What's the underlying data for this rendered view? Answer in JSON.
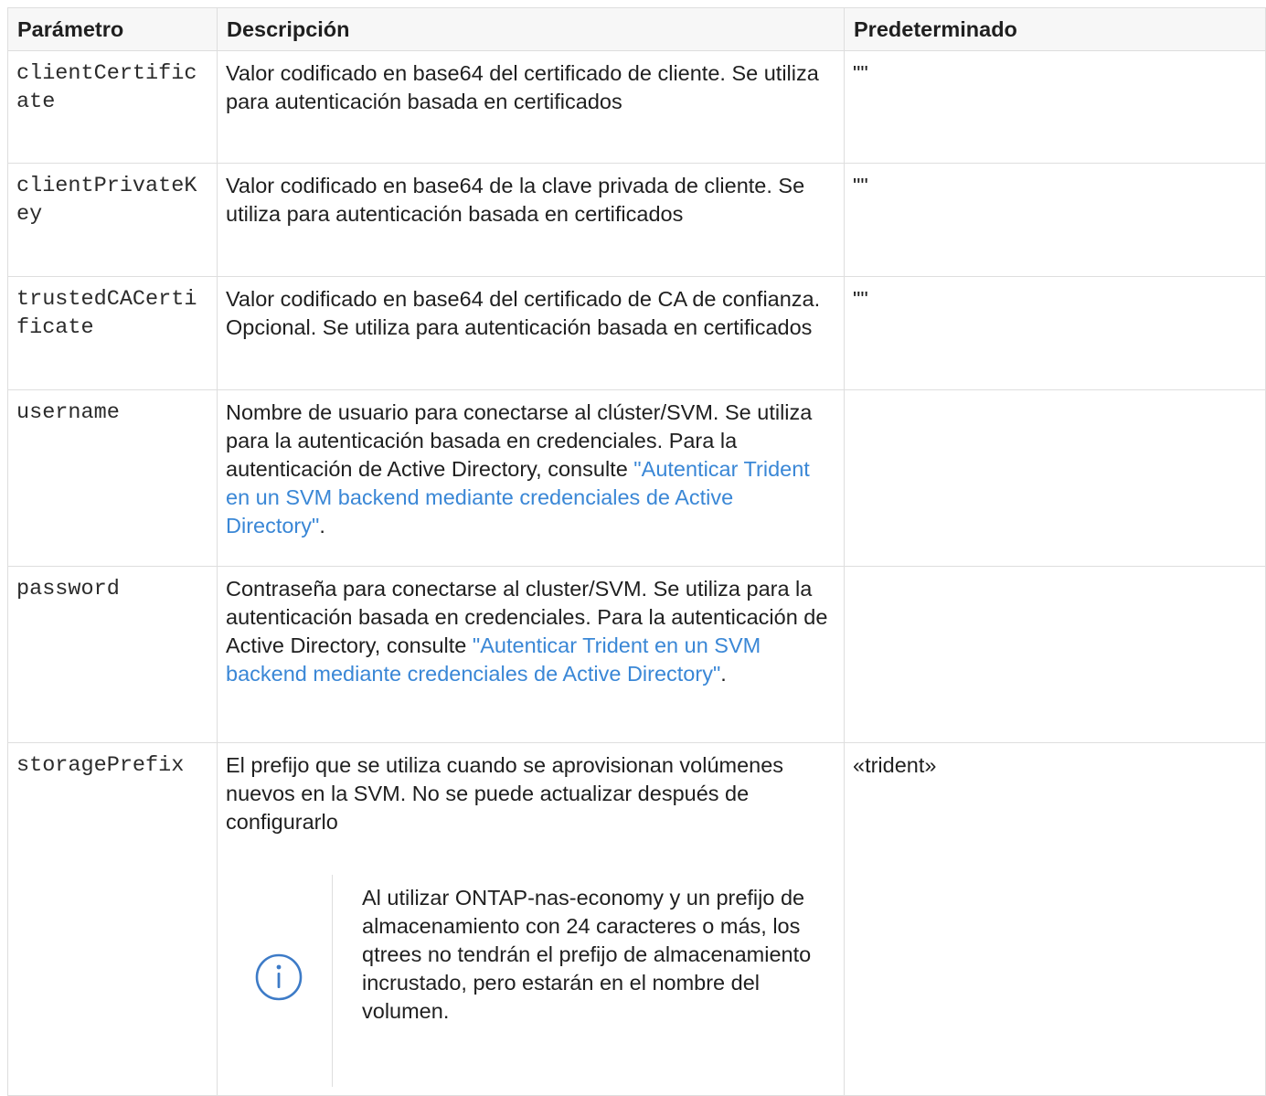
{
  "table": {
    "headers": {
      "parameter": "Parámetro",
      "description": "Descripción",
      "default": "Predeterminado"
    },
    "rows": [
      {
        "param": "clientCertificate",
        "description": "Valor codificado en base64 del certificado de cliente. Se utiliza para autenticación basada en certificados",
        "default": "\"\""
      },
      {
        "param": "clientPrivateKey",
        "description": "Valor codificado en base64 de la clave privada de cliente. Se utiliza para autenticación basada en certificados",
        "default": "\"\""
      },
      {
        "param": "trustedCACertificate",
        "description": "Valor codificado en base64 del certificado de CA de confianza. Opcional. Se utiliza para autenticación basada en certificados",
        "default": "\"\""
      },
      {
        "param": "username",
        "description_before": "Nombre de usuario para conectarse al clúster/SVM. Se utiliza para la autenticación basada en credenciales. Para la autenticación de Active Directory, consulte ",
        "link": "\"Autenticar Trident en un SVM backend mediante credenciales de Active Directory\"",
        "description_after": ".",
        "default": ""
      },
      {
        "param": "password",
        "description_before": "Contraseña para conectarse al cluster/SVM. Se utiliza para la autenticación basada en credenciales. Para la autenticación de Active Directory, consulte ",
        "link": "\"Autenticar Trident en un SVM backend mediante credenciales de Active Directory\"",
        "description_after": ".",
        "default": ""
      },
      {
        "param": "storagePrefix",
        "description": "El prefijo que se utiliza cuando se aprovisionan volúmenes nuevos en la SVM. No se puede actualizar después de configurarlo",
        "note": "Al utilizar ONTAP-nas-economy y un prefijo de almacenamiento con 24 caracteres o más, los qtrees no tendrán el prefijo de almacenamiento incrustado, pero estarán en el nombre del volumen.",
        "note_icon": "info-circle-icon",
        "default": "«trident»"
      }
    ]
  },
  "colors": {
    "link": "#3a87d6",
    "border": "#dedede",
    "header_bg": "#f7f7f7",
    "icon": "#3d7bc7"
  }
}
